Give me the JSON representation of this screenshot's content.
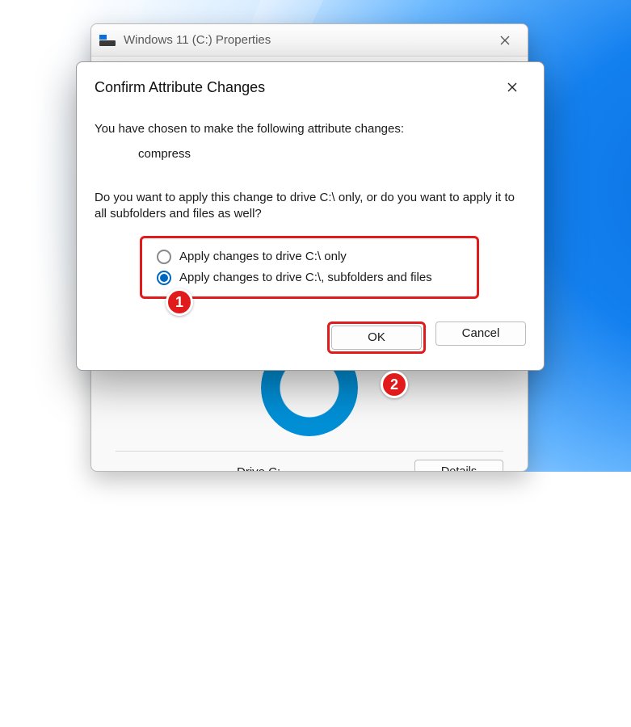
{
  "parent_window": {
    "title": "Windows 11 (C:) Properties",
    "drive_label": "Drive C:",
    "details_button": "Details"
  },
  "dialog": {
    "title": "Confirm Attribute Changes",
    "message1": "You have chosen to make the following attribute changes:",
    "attribute": "compress",
    "message2": "Do you want to apply this change to drive C:\\ only, or do you want to apply it to all subfolders and files as well?",
    "options": {
      "only": "Apply changes to drive C:\\ only",
      "all": "Apply changes to drive C:\\, subfolders and files"
    },
    "selected_option": "all",
    "ok_label": "OK",
    "cancel_label": "Cancel"
  },
  "annotations": {
    "step1": "1",
    "step2": "2"
  }
}
